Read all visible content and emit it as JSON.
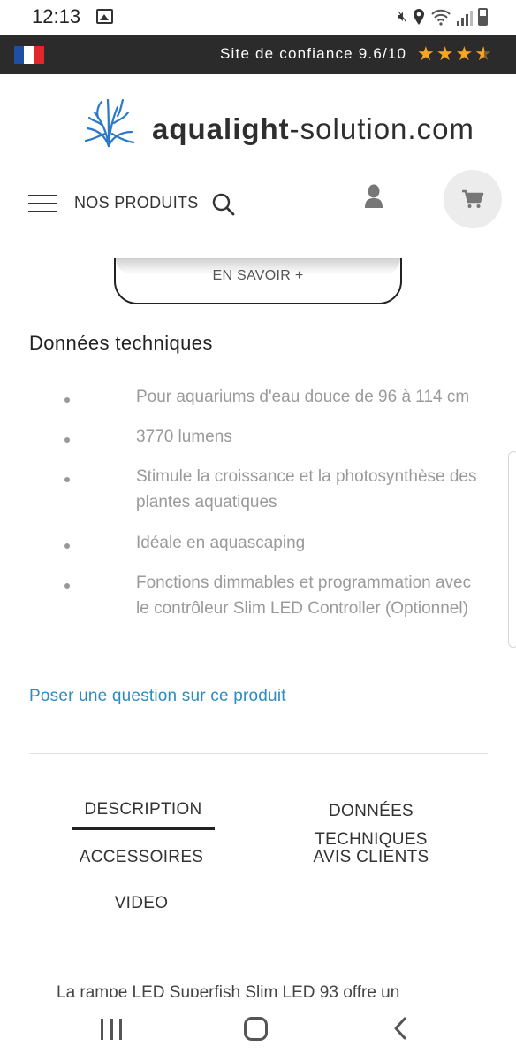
{
  "status_bar": {
    "time": "12:13",
    "icons": [
      "image-icon",
      "mute-icon",
      "location-icon",
      "wifi-icon",
      "signal-icon",
      "battery-icon"
    ]
  },
  "trust_bar": {
    "flag_colors": [
      "#1f4fa3",
      "#ffffff",
      "#e1262d"
    ],
    "text": "Site de confiance 9.6/10",
    "rating": 4.5,
    "star_color": "#f5a623"
  },
  "header": {
    "logo_bold": "aqualight",
    "logo_rest": "-solution.com",
    "logo_color": "#2a78c8",
    "nav_label": "NOS PRODUITS"
  },
  "learn_more": {
    "label": "EN SAVOIR +"
  },
  "tech": {
    "title": "Données techniques",
    "items": [
      "Pour aquariums d'eau douce de 96 à 114 cm",
      "3770 lumens",
      "Stimule la croissance et la photosynthèse des plantes aquatiques",
      "Idéale en aquascaping",
      "Fonctions dimmables et programmation avec le contrôleur Slim LED Controller (Optionnel)"
    ]
  },
  "ask_question": "Poser une question sur ce produit",
  "tabs": {
    "description": "DESCRIPTION",
    "donnees_line1": "DONNÉES",
    "donnees_line2": "TECHNIQUES",
    "accessoires": "ACCESSOIRES",
    "avis": "AVIS CLIENTS",
    "video": "VIDEO",
    "active": "DESCRIPTION"
  },
  "description_text": "La rampe LED Superfish Slim LED 93 offre un",
  "accent_color": "#2d8bbf"
}
